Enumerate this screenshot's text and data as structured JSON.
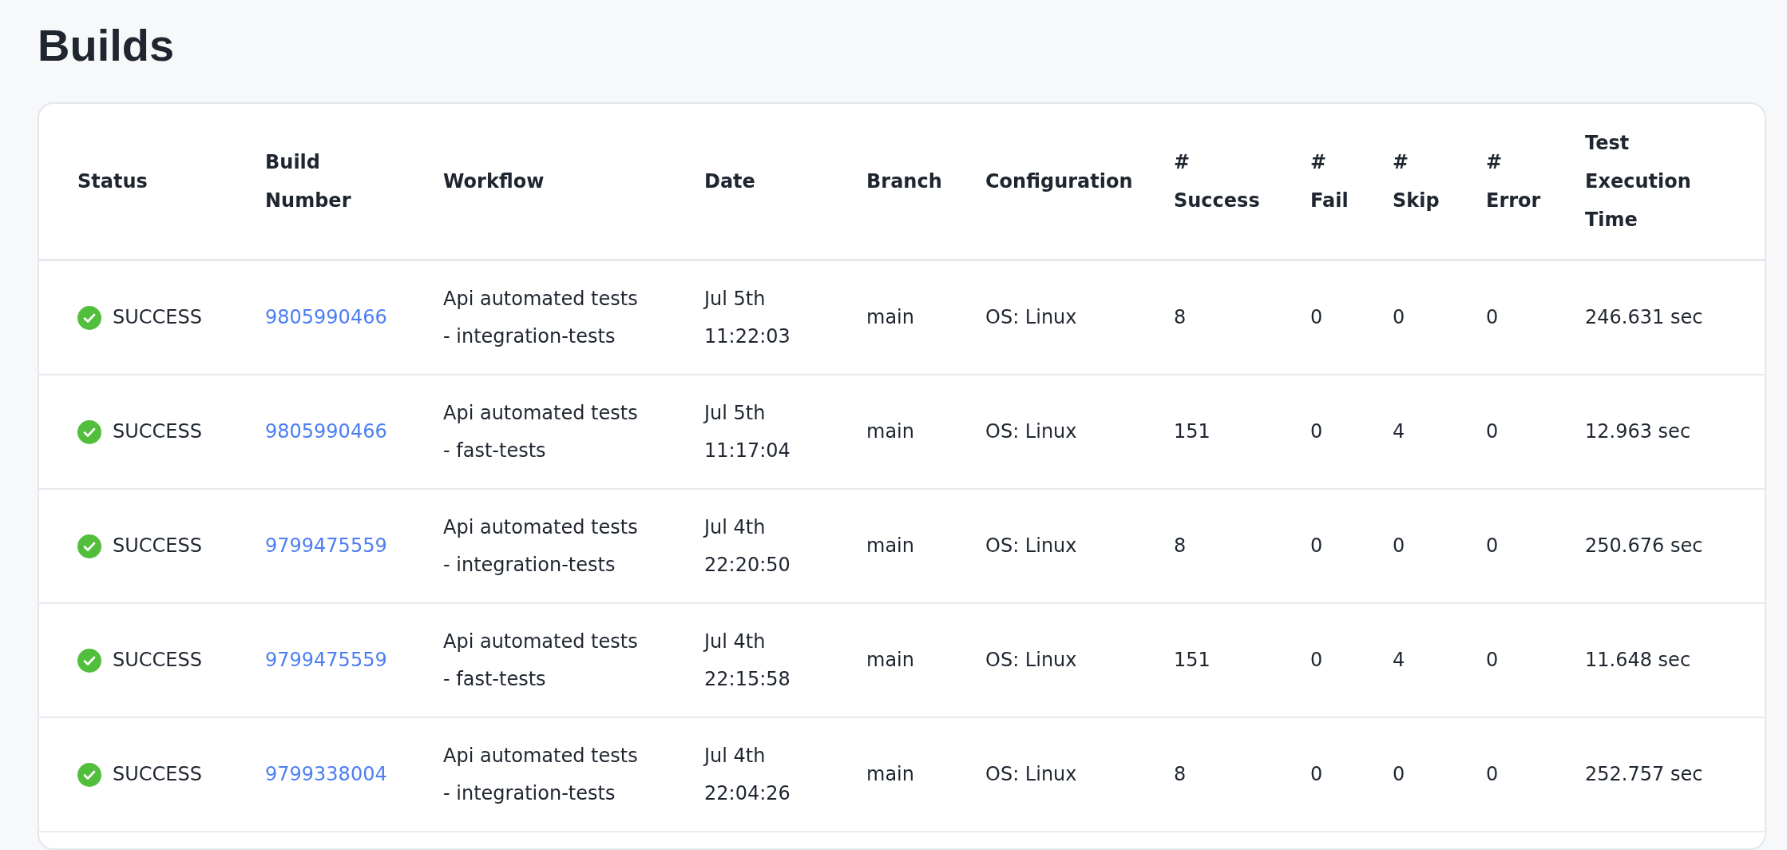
{
  "page_title": "Builds",
  "table": {
    "columns": [
      "Status",
      "Build Number",
      "Workflow",
      "Date",
      "Branch",
      "Configuration",
      "# Success",
      "# Fail",
      "# Skip",
      "# Error",
      "Test Execution Time"
    ],
    "rows": [
      {
        "status": {
          "kind": "success",
          "label": "SUCCESS"
        },
        "build_number": "9805990466",
        "workflow": "Api automated tests\n- integration-tests",
        "date": "Jul 5th\n11:22:03",
        "branch": "main",
        "configuration": "OS: Linux",
        "success": "8",
        "fail": "0",
        "skip": "0",
        "error": "0",
        "time": "246.631 sec"
      },
      {
        "status": {
          "kind": "success",
          "label": "SUCCESS"
        },
        "build_number": "9805990466",
        "workflow": "Api automated tests\n- fast-tests",
        "date": "Jul 5th\n11:17:04",
        "branch": "main",
        "configuration": "OS: Linux",
        "success": "151",
        "fail": "0",
        "skip": "4",
        "error": "0",
        "time": "12.963 sec"
      },
      {
        "status": {
          "kind": "success",
          "label": "SUCCESS"
        },
        "build_number": "9799475559",
        "workflow": "Api automated tests\n- integration-tests",
        "date": "Jul 4th\n22:20:50",
        "branch": "main",
        "configuration": "OS: Linux",
        "success": "8",
        "fail": "0",
        "skip": "0",
        "error": "0",
        "time": "250.676 sec"
      },
      {
        "status": {
          "kind": "success",
          "label": "SUCCESS"
        },
        "build_number": "9799475559",
        "workflow": "Api automated tests\n- fast-tests",
        "date": "Jul 4th\n22:15:58",
        "branch": "main",
        "configuration": "OS: Linux",
        "success": "151",
        "fail": "0",
        "skip": "4",
        "error": "0",
        "time": "11.648 sec"
      },
      {
        "status": {
          "kind": "success",
          "label": "SUCCESS"
        },
        "build_number": "9799338004",
        "workflow": "Api automated tests\n- integration-tests",
        "date": "Jul 4th\n22:04:26",
        "branch": "main",
        "configuration": "OS: Linux",
        "success": "8",
        "fail": "0",
        "skip": "0",
        "error": "0",
        "time": "252.757 sec"
      }
    ]
  }
}
